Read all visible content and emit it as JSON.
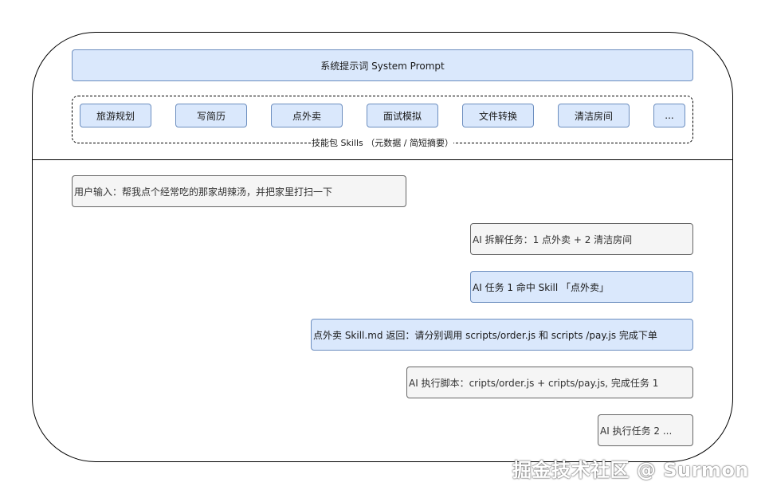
{
  "system_prompt": "系统提示词 System Prompt",
  "skills": {
    "items": [
      "旅游规划",
      "写简历",
      "点外卖",
      "面试模拟",
      "文件转换",
      "清洁房间",
      "..."
    ],
    "label": "技能包 Skills （元数据 / 简短摘要）"
  },
  "messages": [
    "用户输入：帮我点个经常吃的那家胡辣汤，并把家里打扫一下",
    "AI 拆解任务：1 点外卖 + 2 清洁房间",
    "AI 任务 1 命中 Skill 「点外卖」",
    "点外卖 Skill.md 返回：请分别调用 scripts/order.js 和 scripts /pay.js 完成下单",
    "AI 执行脚本：cripts/order.js + cripts/pay.js, 完成任务 1",
    "AI 执行任务 2 ..."
  ],
  "watermark": "掘金技术社区 @ Surmon",
  "colors": {
    "blue_fill": "#dae8fc",
    "blue_stroke": "#6c8ebf",
    "gray_fill": "#f5f5f5",
    "gray_stroke": "#666666"
  }
}
